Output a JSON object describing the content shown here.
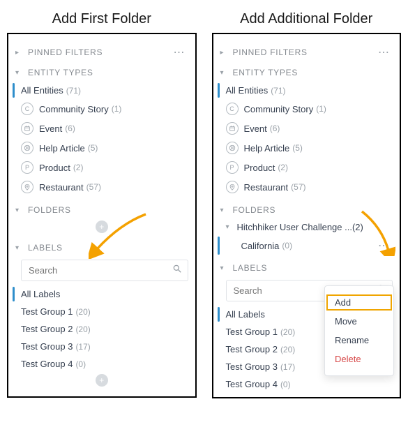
{
  "left_title": "Add First Folder",
  "right_title": "Add Additional Folder",
  "sections": {
    "pinned": "PINNED FILTERS",
    "entity": "ENTITY TYPES",
    "folders": "FOLDERS",
    "labels": "LABELS"
  },
  "entities": {
    "all_name": "All Entities",
    "all_count": "(71)",
    "items": [
      {
        "name": "Community Story",
        "count": "(1)",
        "iconLetter": "C"
      },
      {
        "name": "Event",
        "count": "(6)",
        "iconSvg": "calendar"
      },
      {
        "name": "Help Article",
        "count": "(5)",
        "iconSvg": "help"
      },
      {
        "name": "Product",
        "count": "(2)",
        "iconLetter": "P"
      },
      {
        "name": "Restaurant",
        "count": "(57)",
        "iconSvg": "pin"
      }
    ]
  },
  "folders_right": {
    "group_name": "Hitchhiker User Challenge ...",
    "group_count": "(2)",
    "child_name": "California",
    "child_count": "(0)"
  },
  "search_placeholder": "Search",
  "labels": {
    "all": "All Labels",
    "items": [
      {
        "name": "Test Group 1",
        "count": "(20)"
      },
      {
        "name": "Test Group 2",
        "count": "(20)"
      },
      {
        "name": "Test Group 3",
        "count": "(17)"
      },
      {
        "name": "Test Group 4",
        "count": "(0)"
      }
    ]
  },
  "menu": {
    "add": "Add",
    "move": "Move",
    "rename": "Rename",
    "delete": "Delete"
  }
}
